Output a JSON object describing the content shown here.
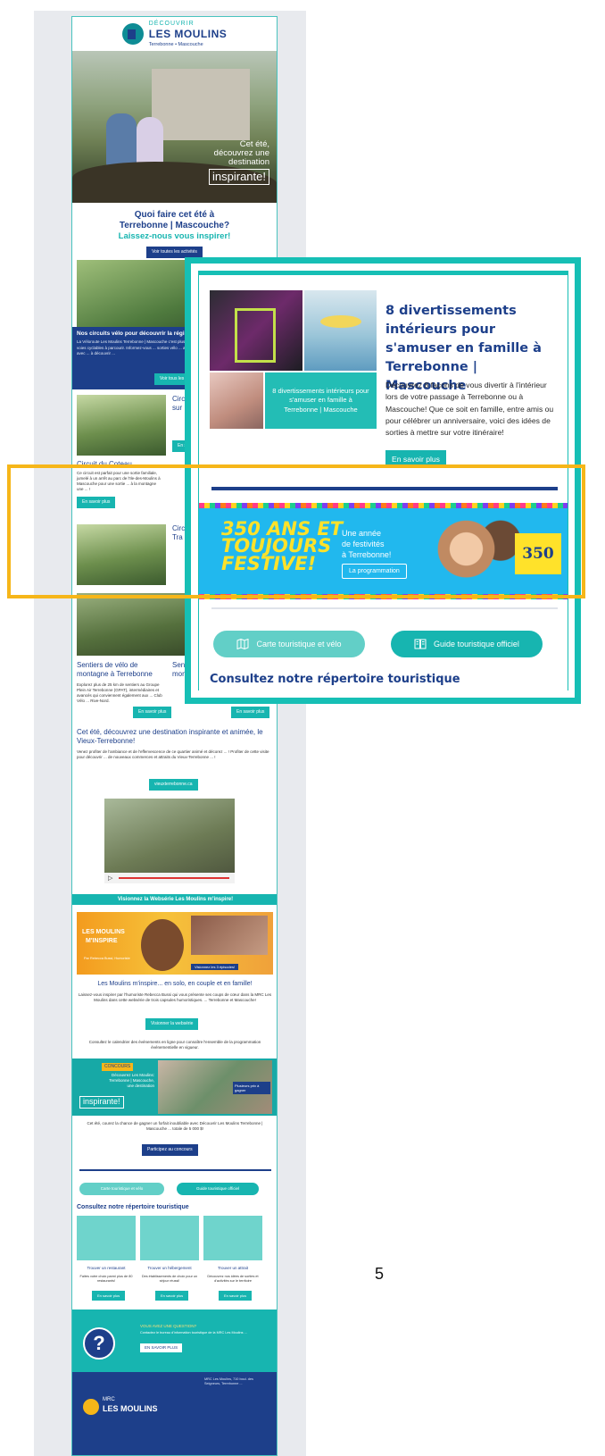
{
  "logo": {
    "line1": "DÉCOUVRIR",
    "line2": "LES MOULINS",
    "line3": "Terrebonne • Mascouche"
  },
  "hero": {
    "caption_line1": "Cet été,",
    "caption_line2": "découvrez une",
    "caption_line3": "destination",
    "caption_box": "inspirante!"
  },
  "intro": {
    "title_line1": "Quoi faire cet été à",
    "title_line2": "Terrebonne | Mascouche?",
    "subtitle": "Laissez-nous vous inspirer!",
    "button": "Voir toutes les activités"
  },
  "bike": {
    "band_title": "Nos circuits vélo pour découvrir la régi",
    "band_text": "La Véloroute Les Moulins Terrebonne | Mascouche c'est plus d'... km de voies cyclables à parcourir. Informez-vous ... sorties vélo ... avec ... ou avec ... à découvrir ...",
    "band_button": "Voir tous les circ",
    "circuit1_title_a": "Circ",
    "circuit1_title_b": "sur",
    "circuit2_title": "Circuit du Coteau",
    "circuit2_text": "Ce circuit est parfait pour une sortie familiale, jumelé à un arrêt au parc de l'Ile-des-Moulins à Mascouche pour une sortie ... à la montagne une ... !",
    "circuit3_title_a": "Circ",
    "circuit3_title_b": "Tra",
    "more": "En savoir plus",
    "mtb_title_a": "Sentiers de vélo de",
    "mtb_title_b": "montagne à Terrebonne",
    "mtb_title_c": "Sen",
    "mtb_title_d": "mon",
    "mtb_text": "Explorez plus de 25 km de sentiers au Groupe Plein Air Terrebonne (GPAT), intermédiaires et avancés qui conviennent également aux ... Club Vélo ... Rive-Nord."
  },
  "vieux": {
    "title": "Cet été, découvrez une destination inspirante et animée, le Vieux-Terrebonne!",
    "text": "Venez profiter de l'ambiance et de l'effervescence de ce quartier animé et décorez ... ! Profiter de cette visite pour découvrir ... de nouveaux commerces et attraits du Vieux-Terrebonne ... !",
    "button": "vieuxterrebonne.ca"
  },
  "webserie": {
    "band": "Visionnez la Websérie Les Moulins m'inspire!",
    "brand_a": "LES MOULINS",
    "brand_b": "M'INSPIRE",
    "host": "Par Rebecca Bussi, Humoriste",
    "badge": "Visionnez les 3 épisodes!",
    "title": "Les Moulins m'inspire... en solo, en couple et en famille!",
    "text": "Laissez-vous inspirer par l'humoriste Rebecca Bussi qui vous présente ses coups de cœur dans la MRC Les Moulins dans cette websérie de trois capsules humoristiques. ... Terrebonne et Mascouche!",
    "button": "Visionner la websérie",
    "calendar_text": "Consultez le calendrier des événements en ligne pour connaître l'ensemble de la programmation événementielle en vigueur."
  },
  "contest": {
    "tag": "CONCOURS",
    "line1": "Découvrez Les Moulins:",
    "line2": "Terrebonne | Mascouche,",
    "line3": "une destination",
    "box": "inspirante!",
    "prize": "Plusieurs prix à gagner",
    "text": "Cet été, courez la chance de gagner un forfait inoubliable avec Découvrir Les Moulins Terrebonne | Mascouche ... totale de 5 000 $!",
    "button": "Participez au concours"
  },
  "bottom": {
    "pill_map": "Carte touristique et vélo",
    "pill_guide": "Guide touristique officiel",
    "directory": "Consultez notre répertoire touristique",
    "cards": [
      {
        "title": "Trouver un restaurant",
        "text": "Faites votre choix parmi plus de 80 restaurants!",
        "button": "En savoir plus"
      },
      {
        "title": "Trouver un hébergement",
        "text": "Des établissements de choix pour un séjour réussi!",
        "button": "En savoir plus"
      },
      {
        "title": "Trouver un attrait",
        "text": "Découvrez nos idées de sorties et d'activités sur le territoire",
        "button": "En savoir plus"
      }
    ],
    "question": "VOUS AVEZ UNE QUESTION?",
    "question_text": "Contactez le bureau d'information touristique de la MRC Les Moulins ...",
    "question_button": "EN SAVOIR PLUS",
    "footer_brand_a": "MRC",
    "footer_brand_b": "LES MOULINS",
    "footer_addr": "MRC Les Moulins, 710 boul. des Seigneurs, Terrebonne ..."
  },
  "zoom": {
    "collage_caption": "8 divertissements intérieurs pour s'amuser en famille à Terrebonne | Mascouche",
    "title": "8 divertissements intérieurs pour s'amuser en famille à Terrebonne | Mascouche",
    "body": "Découvrez 8 façons de vous divertir à l'intérieur lors de votre passage à Terrebonne ou à Mascouche! Que ce soit en famille, entre amis ou pour célébrer un anniversaire, voici des idées de sorties à mettre sur votre itinéraire!",
    "button": "En savoir plus",
    "festive_big_1": "350 ANS ET",
    "festive_big_2": "TOUJOURS",
    "festive_big_3": "FESTIVE!",
    "festive_sub_1": "Une année",
    "festive_sub_2": "de festivités",
    "festive_sub_3": "à Terrebonne!",
    "festive_button": "La programmation",
    "festive_badge": "350",
    "pill_map": "Carte touristique et vélo",
    "pill_guide": "Guide touristique officiel",
    "directory": "Consultez notre répertoire touristique"
  },
  "page_number": "5",
  "colors": {
    "navy": "#1d3f8a",
    "teal": "#17b5b0",
    "highlight": "#f6b619",
    "frame": "#16bfb5"
  }
}
